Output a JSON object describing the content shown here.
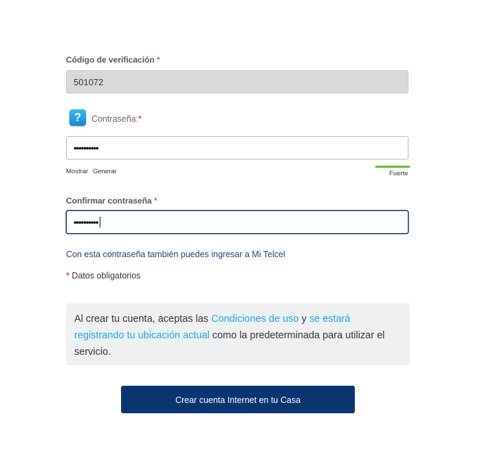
{
  "verification": {
    "label": "Código de verificación",
    "required_mark": "*",
    "value": "501072"
  },
  "password": {
    "label": "Contraseña:",
    "required_mark": "*",
    "masked_value": "••••••••••",
    "show_label": "Mostrar",
    "generate_label": "Generar",
    "strength_label": "Fuerte",
    "strength_level": 1.0,
    "help_icon": "question-icon"
  },
  "confirm": {
    "label": "Confirmar contraseña",
    "required_mark": "*",
    "masked_value": "••••••••••"
  },
  "info_link": "Con esta contraseña también puedes ingresar a Mi Telcel",
  "required_note": {
    "mark": "*",
    "text": "Datos obligatorios"
  },
  "notice": {
    "part1": "Al crear tu cuenta, aceptas las ",
    "link1": "Condiciones de uso",
    "part2": " y ",
    "link2": "se estará registrando tu ubicación actual",
    "part3": " como la predeterminada para utilizar el servicio."
  },
  "submit_label": "Crear cuenta Internet en tu Casa",
  "colors": {
    "primary": "#0b3572",
    "link": "#20a7df",
    "required": "#e4002b",
    "strength": "#66c02b"
  }
}
